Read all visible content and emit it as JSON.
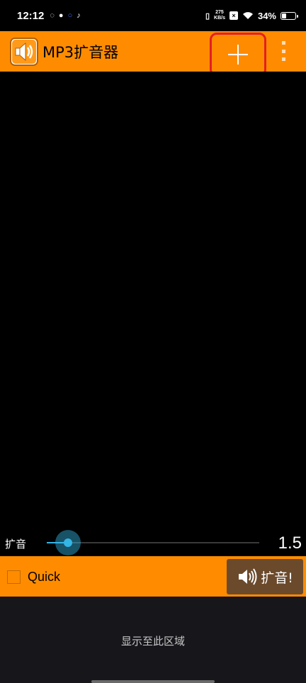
{
  "status_bar": {
    "time": "12:12",
    "net_speed_value": "275",
    "net_speed_unit": "KB/s",
    "battery_percent": "34%",
    "battery_level": 0.34,
    "icons": [
      "sync-icon",
      "wechat-icon",
      "circle-app-icon",
      "tiktok-icon",
      "vibrate-icon",
      "no-sim-icon",
      "wifi-icon",
      "battery-icon"
    ]
  },
  "action_bar": {
    "title": "MP3扩音器",
    "add_icon": "plus-icon",
    "menu_icon": "overflow-menu-icon"
  },
  "slider": {
    "label": "扩音",
    "value_text": "1.5",
    "fraction": 0.1
  },
  "controls": {
    "quick_label": "Quick",
    "quick_checked": false,
    "amplify_label": "扩音!"
  },
  "bottom": {
    "text": "显示至此区域"
  },
  "colors": {
    "accent": "#ff8c00",
    "slider": "#33b5e5",
    "highlight": "#e41e26",
    "amplify_button": "#6b4a2c"
  }
}
